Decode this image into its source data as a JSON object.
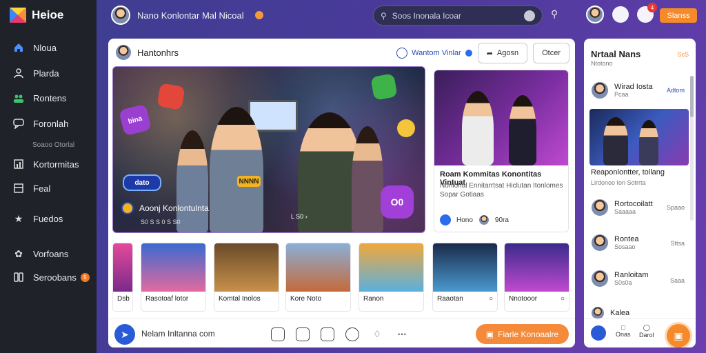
{
  "app": {
    "name": "Heioe"
  },
  "sidebar": {
    "items": [
      {
        "label": "Nloua",
        "icon": "home-icon"
      },
      {
        "label": "Plarda",
        "icon": "profile-icon"
      },
      {
        "label": "Rontens",
        "icon": "community-icon"
      },
      {
        "label": "Foronlah",
        "icon": "chat-icon"
      },
      {
        "label": "Kortormitas",
        "icon": "chart-icon"
      },
      {
        "label": "Feal",
        "icon": "grid-icon"
      },
      {
        "label": "Fuedos",
        "icon": "star-icon"
      },
      {
        "label": "Vorfoans",
        "icon": "settings-icon"
      },
      {
        "label": "Seroobans",
        "icon": "link-icon",
        "badge": "5"
      }
    ],
    "section_label": "Soaoo Otorlal"
  },
  "header": {
    "user_name": "Nano Konlontar Mal Nicoal",
    "search_placeholder": "Soos Inonala Icoar",
    "notif_count": "4",
    "share_label": "Slanss"
  },
  "main": {
    "title": "Hantonhrs",
    "link_label": "Wantom Vinlar",
    "btn_agosn": "Agosn",
    "btn_otcer": "Otcer",
    "hero": {
      "caption": "Aoonj Konlontulnta",
      "sub": "S0  S  S 0  S  S0 ",
      "more": "L  S0 ",
      "stickers": [
        "bina",
        "dato",
        "NNNN",
        "O0"
      ]
    },
    "side_card": {
      "title": "Roam Kommitas Konontitas Vintuat",
      "desc": "Nonlonal Ennitarrtsat Hiclutan Itonlomes Sopar Gotiaas",
      "meta_name": "Hono",
      "meta_extra": "90ra"
    },
    "thumbs": [
      {
        "label": "Dsb"
      },
      {
        "label": "Rasotoaf lotor"
      },
      {
        "label": "Komtal Inolos"
      },
      {
        "label": "Kore Noto"
      },
      {
        "label": "Ranon"
      },
      {
        "label": "Raaotan"
      },
      {
        "label": "Nnotooor"
      }
    ],
    "bottom": {
      "input_label": "Nelam Inltanna com",
      "cta_label": "Fiarle Konoaalre"
    }
  },
  "right": {
    "title": "Nrtaal Nans",
    "subtitle": "Ntotono",
    "live": "ScS",
    "top_row": {
      "name": "Wirad Iosta",
      "meta": "Pcaa",
      "link": "Adtom"
    },
    "feature_caption": "Reaponlontter, tollang",
    "feature_sub": "Lirdonoo Ion Sotrrta",
    "list": [
      {
        "name": "Rortocoilatt",
        "meta": "Saaaaa",
        "link": "Spaao"
      },
      {
        "name": "Rontea",
        "meta": "Sosaao",
        "link": "Sttsa"
      },
      {
        "name": "Ranloitam",
        "meta": "S0s0a",
        "link": "Saaa"
      },
      {
        "name": "Kalea",
        "meta": "",
        "link": ""
      }
    ],
    "foot_labels": [
      "Onas",
      "Darol"
    ]
  },
  "colors": {
    "accent": "#f58a2a",
    "sidebar": "#20222a",
    "link": "#2a4db0"
  }
}
